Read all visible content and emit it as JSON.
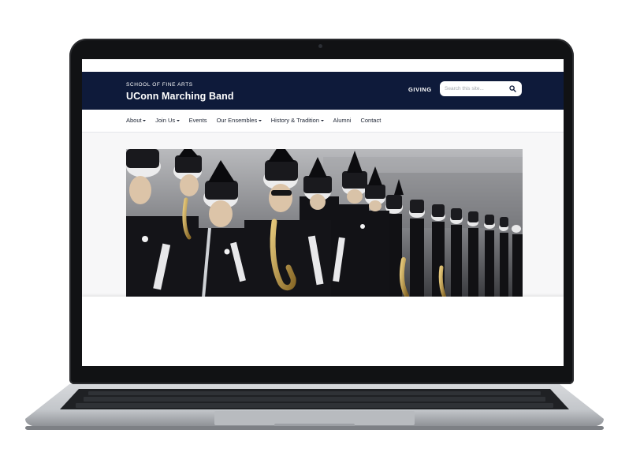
{
  "site": {
    "eyebrow": "SCHOOL OF FINE ARTS",
    "title": "UConn Marching Band",
    "giving_label": "GIVING",
    "search_placeholder": "Search this site..."
  },
  "nav": {
    "items": [
      {
        "label": "About",
        "dropdown": true
      },
      {
        "label": "Join Us",
        "dropdown": true
      },
      {
        "label": "Events",
        "dropdown": false
      },
      {
        "label": "Our Ensembles",
        "dropdown": true
      },
      {
        "label": "History & Tradition",
        "dropdown": true
      },
      {
        "label": "Alumni",
        "dropdown": false
      },
      {
        "label": "Contact",
        "dropdown": false
      }
    ]
  },
  "hero": {
    "image_alt": "Marching band members in black and white uniforms with plumed shakos holding saxophones"
  },
  "colors": {
    "header_bg": "#0e1a3a",
    "header_text": "#ffffff",
    "nav_text": "#1d2433"
  },
  "icons": {
    "search": "search-icon",
    "caret": "caret-down-icon"
  }
}
